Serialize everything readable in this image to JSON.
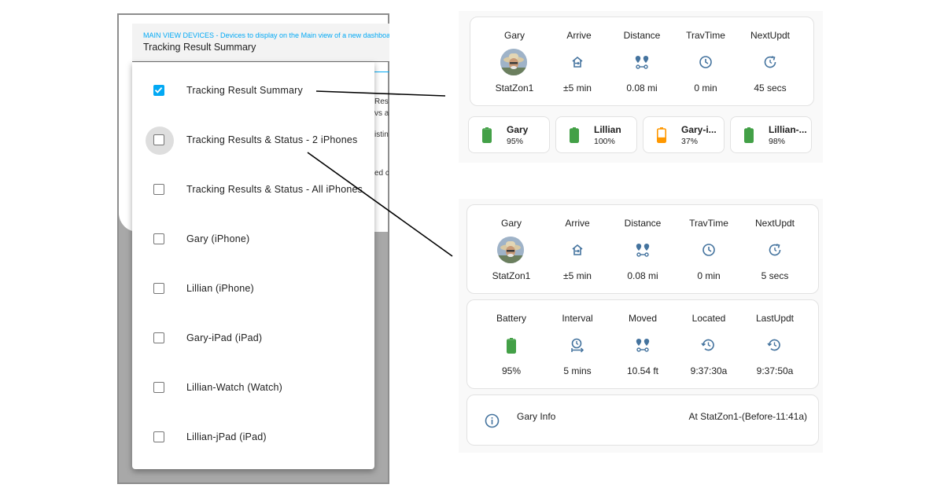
{
  "dialog": {
    "field_label": "MAIN VIEW DEVICES - Devices to display on the Main view of a new dashboard",
    "field_value": "Tracking Result Summary",
    "background_text": [
      "Res",
      "vs a",
      "istin",
      "ed c"
    ]
  },
  "menu": {
    "items": [
      {
        "label": "Tracking Result Summary",
        "checked": true
      },
      {
        "label": "Tracking Results & Status - 2 iPhones",
        "checked": false
      },
      {
        "label": "Tracking Results & Status - All iPhones",
        "checked": false
      },
      {
        "label": "Gary (iPhone)",
        "checked": false
      },
      {
        "label": "Lillian (iPhone)",
        "checked": false
      },
      {
        "label": "Gary-iPad (iPad)",
        "checked": false
      },
      {
        "label": "Lillian-Watch (Watch)",
        "checked": false
      },
      {
        "label": "Lillian-jPad (iPad)",
        "checked": false
      }
    ]
  },
  "summary_card": {
    "headers": [
      "Gary",
      "Arrive",
      "Distance",
      "TravTime",
      "NextUpdt"
    ],
    "values": [
      "StatZon1",
      "±5 min",
      "0.08 mi",
      "0 min",
      "45 secs"
    ],
    "icons": [
      "avatar",
      "home-arrow-icon",
      "map-markers-icon",
      "clock-icon",
      "refresh-clock-icon"
    ]
  },
  "battery_cards": [
    {
      "name": "Gary",
      "percent": "95%",
      "level": 0.95,
      "color": "#43a047"
    },
    {
      "name": "Lillian",
      "percent": "100%",
      "level": 1.0,
      "color": "#43a047"
    },
    {
      "name": "Gary-i...",
      "percent": "37%",
      "level": 0.37,
      "color": "#ff9800"
    },
    {
      "name": "Lillian-...",
      "percent": "98%",
      "level": 0.98,
      "color": "#43a047"
    }
  ],
  "status_card": {
    "headers": [
      "Gary",
      "Arrive",
      "Distance",
      "TravTime",
      "NextUpdt"
    ],
    "values": [
      "StatZon1",
      "±5 min",
      "0.08 mi",
      "0 min",
      "5 secs"
    ]
  },
  "detail_card": {
    "headers": [
      "Battery",
      "Interval",
      "Moved",
      "Located",
      "LastUpdt"
    ],
    "values": [
      "95%",
      "5 mins",
      "10.54 ft",
      "9:37:30a",
      "9:37:50a"
    ],
    "battery_level": 0.95
  },
  "info_card": {
    "name": "Gary Info",
    "status": "At StatZon1-(Before-11:41a)"
  },
  "colors": {
    "accent": "#03a9f4",
    "icon": "#44739e",
    "battery_ok": "#43a047",
    "battery_low": "#ff9800"
  }
}
